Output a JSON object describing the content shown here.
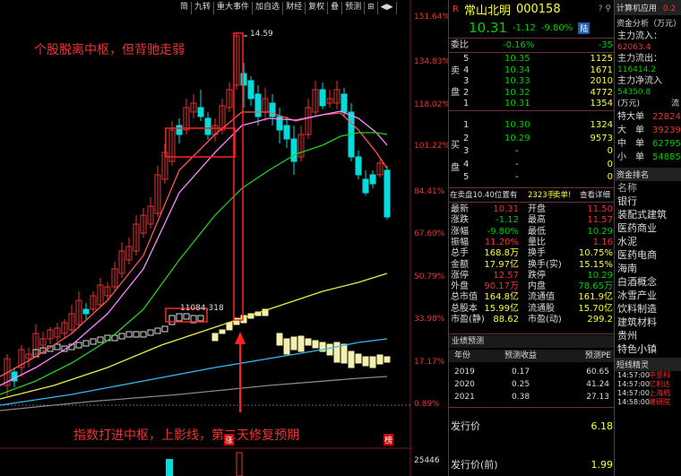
{
  "toolbar": [
    "简",
    "九转",
    "重大事件",
    "加自选",
    "财经",
    "复权",
    "叠",
    "预测",
    "⊞",
    "◀▶"
  ],
  "pct_axis": [
    "151.64%",
    "134.83%",
    "118.02%",
    "101.22%",
    "84.41%",
    "67.60%",
    "50.79%",
    "33.98%",
    "17.17%",
    "0.89%"
  ],
  "vol_axis": "25446",
  "high_label": "14.59",
  "low_label": "11084.318",
  "annot_top": "个股脱离中枢，但背驰走弱",
  "annot_bottom": "指数打进中枢，上影线，第二天修复预期",
  "marks": {
    "zhang": "涨",
    "bang": "榜"
  },
  "stock": {
    "r": "R",
    "name": "常山北明",
    "code": "000158",
    "icons": "? ⚲",
    "price": "10.31",
    "chg": "-1.12",
    "pct": "-9.80%",
    "tag": "陆"
  },
  "weibi": {
    "label": "委比",
    "pct": "-0.16%",
    "val": "-35"
  },
  "asks": [
    {
      "n": "5",
      "p": "10.35",
      "v": "1125"
    },
    {
      "n": "4",
      "p": "10.34",
      "v": "1671"
    },
    {
      "n": "3",
      "p": "10.33",
      "v": "2010"
    },
    {
      "n": "2",
      "p": "10.32",
      "v": "4772"
    },
    {
      "n": "1",
      "p": "10.31",
      "v": "1354"
    }
  ],
  "ask_side": [
    "卖",
    "盘"
  ],
  "bids": [
    {
      "n": "1",
      "p": "10.30",
      "v": "1324"
    },
    {
      "n": "2",
      "p": "10.29",
      "v": "9573"
    },
    {
      "n": "3",
      "p": "-",
      "v": "0"
    },
    {
      "n": "4",
      "p": "-",
      "v": "0"
    },
    {
      "n": "5",
      "p": "-",
      "v": "0"
    }
  ],
  "bid_side": [
    "买",
    "盘"
  ],
  "sellnote": {
    "a": "在卖盘10.40位置有",
    "b": "2323手",
    "c": "卖单!",
    "d": "查看详细"
  },
  "quote": [
    [
      "最新",
      "10.31",
      "开盘",
      "11.50"
    ],
    [
      "涨跌",
      "-1.12",
      "最高",
      "11.57"
    ],
    [
      "涨幅",
      "-9.80%",
      "最低",
      "10.29"
    ],
    [
      "振幅",
      "11.20%",
      "量比",
      "1.16"
    ],
    [
      "总手",
      "168.8万",
      "换手",
      "10.75%"
    ],
    [
      "金额",
      "17.97亿",
      "换手(实)",
      "15.15%"
    ],
    [
      "涨停",
      "12.57",
      "跌停",
      "10.29"
    ],
    [
      "外盘",
      "90.17万",
      "内盘",
      "78.65万"
    ],
    [
      "总市值",
      "164.8亿",
      "流通值",
      "161.9亿"
    ],
    [
      "总股本",
      "15.99亿",
      "流通股",
      "15.70亿"
    ],
    [
      "市盈(静)",
      "88.62",
      "市盈(动)",
      "299.2"
    ]
  ],
  "forecast": {
    "tab": "业绩预测",
    "cols": [
      "年份",
      "预测收益",
      "预测PE"
    ],
    "rows": [
      [
        "2019",
        "0.17",
        "60.65"
      ],
      [
        "2020",
        "0.25",
        "41.24"
      ],
      [
        "2021",
        "0.38",
        "27.13"
      ]
    ]
  },
  "issue": [
    {
      "label": "发行价",
      "val": "6.18"
    },
    {
      "label": "发行价(前)",
      "val": "1.99"
    }
  ],
  "far": {
    "tab": "计算机应用",
    "tab_val": "0.2",
    "flow_title": "资金分析（万元）",
    "flow": [
      [
        "主力流入：",
        "62063.4"
      ],
      [
        "主力流出：",
        "116414.2"
      ],
      [
        "主力净流入",
        "54350.8"
      ]
    ],
    "unit": "(万元)",
    "unit_r": "流",
    "sizes": [
      [
        "特大单",
        "22824"
      ],
      [
        "大　单",
        "39239"
      ],
      [
        "中　单",
        "62795"
      ],
      [
        "小　单",
        "54885"
      ]
    ],
    "rank_title": "资金排名",
    "rank": [
      "名称",
      "银行",
      "装配式建筑",
      "医药商业",
      "水泥",
      "医药电商",
      "海南",
      "白酒概念",
      "冰雪产业",
      "饮料制造",
      "建筑材料",
      "贵州",
      "特色小镇"
    ],
    "news_title": "短线精灵",
    "news": [
      [
        "14:57:00",
        "中坚科"
      ],
      [
        "14:57:00",
        "亿利达"
      ],
      [
        "14:57:00",
        "上海机"
      ],
      [
        "14:58:00",
        "建研院"
      ]
    ]
  },
  "colors": {
    "up": "#e33333",
    "down": "#00cc00",
    "ma5": "#ff5555",
    "ma10": "#ff88ff",
    "ma20": "#22cc22",
    "ma60": "#eeee44",
    "ma120": "#33bbee",
    "ma250": "#888888"
  }
}
